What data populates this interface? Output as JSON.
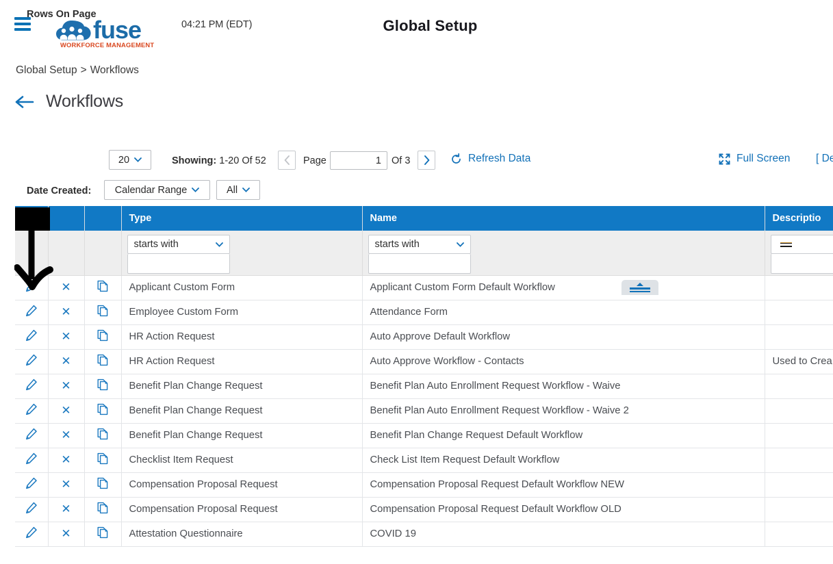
{
  "header": {
    "menu_icon": "hamburger-icon",
    "logo_wordmark": "fuse",
    "logo_tagline": "WORKFORCE MANAGEMENT",
    "clock": "04:21 PM (EDT)",
    "title": "Global Setup"
  },
  "breadcrumb": {
    "root": "Global Setup",
    "separator": ">",
    "current": "Workflows"
  },
  "page": {
    "back_icon": "back-arrow-icon",
    "heading": "Workflows"
  },
  "toolbar": {
    "rows_on_page_label": "Rows On Page",
    "rows_on_page_value": "20",
    "showing_label": "Showing:",
    "showing_value": "1-20 Of 52",
    "prev_icon": "chevron-left-icon",
    "page_label": "Page",
    "page_value": "1",
    "of_label": "Of 3",
    "next_icon": "chevron-right-icon",
    "refresh_icon": "refresh-icon",
    "refresh_label": "Refresh Data",
    "fullscreen_icon": "fullscreen-icon",
    "fullscreen_label": "Full Screen",
    "defaults_label": "[ De",
    "date_created_label": "Date Created:",
    "date_range_value": "Calendar Range",
    "date_all_value": "All"
  },
  "grid": {
    "columns": [
      {
        "key": "marker",
        "label": ""
      },
      {
        "key": "edit",
        "label": ""
      },
      {
        "key": "delete",
        "label": ""
      },
      {
        "key": "copy",
        "label": ""
      },
      {
        "key": "type",
        "label": "Type"
      },
      {
        "key": "name",
        "label": "Name"
      },
      {
        "key": "spacer",
        "label": ""
      },
      {
        "key": "description",
        "label": "Descriptio"
      }
    ],
    "filters": {
      "type_operator": "starts with",
      "type_value": "",
      "name_operator": "starts with",
      "name_value": "",
      "description_operator": "=",
      "description_value": ""
    },
    "row_icons": {
      "edit": "pencil-icon",
      "delete": "x-icon",
      "copy": "copy-icon"
    },
    "collapse_tab_icon": "collapse-filters-icon",
    "rows": [
      {
        "type": "Applicant Custom Form",
        "name": "Applicant Custom Form Default Workflow",
        "description": ""
      },
      {
        "type": "Employee Custom Form",
        "name": "Attendance Form",
        "description": ""
      },
      {
        "type": "HR Action Request",
        "name": "Auto Approve Default Workflow",
        "description": ""
      },
      {
        "type": "HR Action Request",
        "name": "Auto Approve Workflow - Contacts",
        "description": "Used to Crea"
      },
      {
        "type": "Benefit Plan Change Request",
        "name": "Benefit Plan Auto Enrollment Request Workflow - Waive",
        "description": ""
      },
      {
        "type": "Benefit Plan Change Request",
        "name": "Benefit Plan Auto Enrollment Request Workflow - Waive 2",
        "description": ""
      },
      {
        "type": "Benefit Plan Change Request",
        "name": "Benefit Plan Change Request Default Workflow",
        "description": ""
      },
      {
        "type": "Checklist Item Request",
        "name": "Check List Item Request Default Workflow",
        "description": ""
      },
      {
        "type": "Compensation Proposal Request",
        "name": "Compensation Proposal Request Default Workflow NEW",
        "description": ""
      },
      {
        "type": "Compensation Proposal Request",
        "name": "Compensation Proposal Request Default Workflow OLD",
        "description": ""
      },
      {
        "type": "Attestation Questionnaire",
        "name": "COVID 19",
        "description": ""
      }
    ]
  },
  "annotation": {
    "shape": "down-arrow-annotation",
    "color": "#000000"
  },
  "colors": {
    "header_blue": "#1179c5",
    "link_blue": "#1271b8",
    "logo_blue": "#1c6ca8",
    "logo_orange": "#d9471f"
  }
}
